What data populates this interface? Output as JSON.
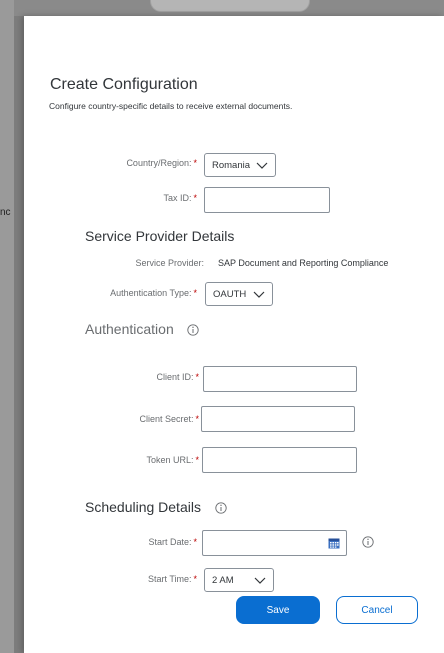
{
  "backdrop": {
    "fragment": "nc"
  },
  "dialog": {
    "title": "Create Configuration",
    "subtitle": "Configure country-specific details to receive external documents."
  },
  "general": {
    "country_label": "Country/Region:",
    "country_value": "Romania",
    "tax_id_label": "Tax ID:",
    "tax_id_value": ""
  },
  "service_provider": {
    "section_title": "Service Provider Details",
    "provider_label": "Service Provider:",
    "provider_value": "SAP Document and Reporting Compliance",
    "auth_type_label": "Authentication Type:",
    "auth_type_value": "OAUTH"
  },
  "authentication": {
    "section_title": "Authentication",
    "client_id_label": "Client ID:",
    "client_secret_label": "Client Secret:",
    "token_url_label": "Token URL:"
  },
  "scheduling": {
    "section_title": "Scheduling Details",
    "start_date_label": "Start Date:",
    "start_time_label": "Start Time:",
    "start_time_value": "2 AM"
  },
  "footer": {
    "save_label": "Save",
    "cancel_label": "Cancel"
  },
  "required_marker": "*",
  "icons": {
    "info": "info-icon",
    "calendar": "calendar-icon",
    "dropdown": "chevron-down-icon"
  },
  "colors": {
    "primary": "#0a6ed1",
    "required": "#bb0000",
    "calendar": "#3a6fc0"
  }
}
